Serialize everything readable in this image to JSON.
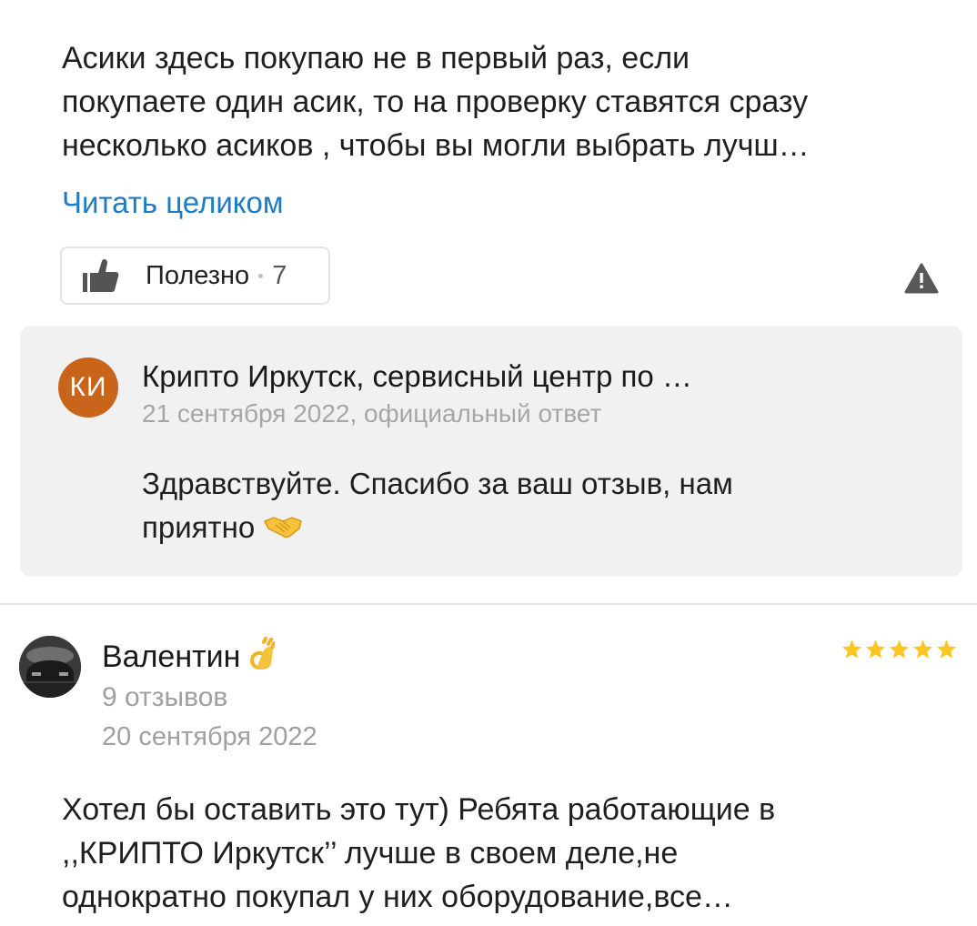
{
  "review1": {
    "text_lines": [
      "Асики здесь покупаю не в первый раз, если",
      "покупаете один асик, то на проверку ставятся сразу",
      "несколько асиков , чтобы вы могли выбрать лучш…"
    ],
    "read_more": "Читать целиком",
    "useful_label": "Полезно",
    "useful_count": "7",
    "icons": {
      "like": "thumbs-up-icon",
      "report": "warning-triangle-icon"
    }
  },
  "reply": {
    "avatar_initials": "КИ",
    "avatar_color": "#c8651b",
    "author": "Крипто Иркутск, сервисный центр по …",
    "meta": "21 сентября 2022, официальный ответ",
    "text_lines": [
      "Здравствуйте. Спасибо за ваш отзыв, нам",
      "приятно"
    ],
    "emoji": "handshake-emoji"
  },
  "review2": {
    "author": "Валентин",
    "author_emoji": "ok-hand-emoji",
    "reviews_count": "9 отзывов",
    "date": "20 сентября 2022",
    "rating": 5,
    "rating_max": 5,
    "star_color": "#fcc521",
    "text_lines": [
      "Хотел бы оставить это тут) Ребята работающие в",
      ",,КРИПТО Иркутск’’ лучше в своем деле,не",
      "однократно покупал у них оборудование,все…"
    ]
  },
  "colors": {
    "link": "#1f7cc0",
    "muted": "#a6a6a6",
    "reply_bg": "#f1f1f1"
  }
}
